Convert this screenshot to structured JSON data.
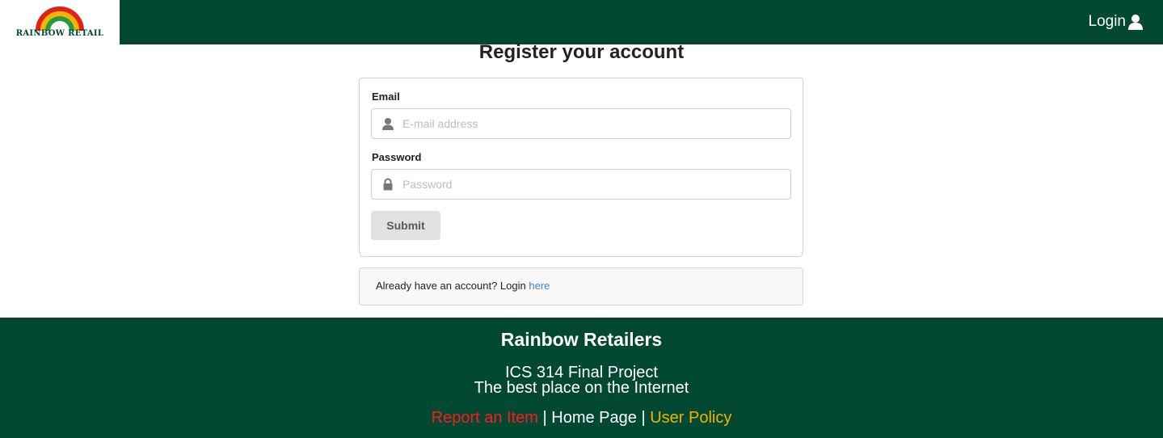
{
  "header": {
    "logo_text": "RAINBOW RETAIL",
    "login_label": "Login",
    "login_icon": "user-icon",
    "bg_color": "#034833"
  },
  "main": {
    "title": "Register your account",
    "email": {
      "label": "Email",
      "placeholder": "E-mail address",
      "icon": "user-icon"
    },
    "password": {
      "label": "Password",
      "placeholder": "Password",
      "icon": "lock-icon"
    },
    "submit_label": "Submit",
    "login_prompt": "Already have an account? Login ",
    "login_here": "here"
  },
  "footer": {
    "title": "Rainbow Retailers",
    "line1": "ICS 314 Final Project",
    "line2": "The best place on the Internet",
    "links": {
      "report": "Report an Item",
      "home": "Home Page",
      "policy": "User Policy",
      "separator": " | "
    },
    "colors": {
      "report": "#ff1a1a",
      "home": "#ffffff",
      "policy": "#f2b100"
    }
  }
}
